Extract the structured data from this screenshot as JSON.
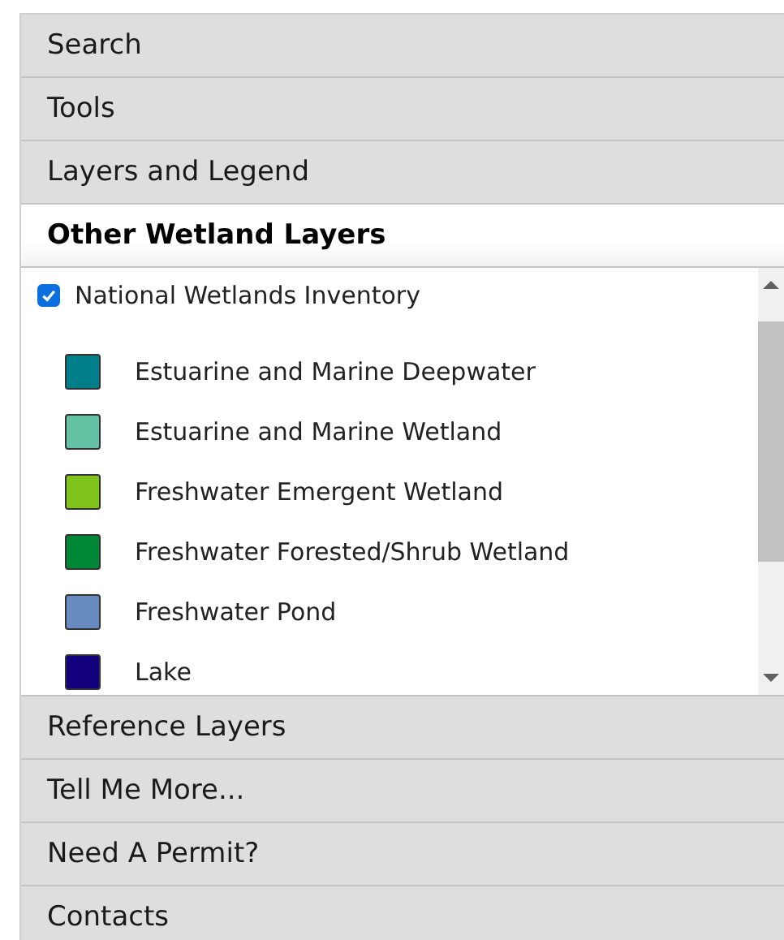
{
  "sections": [
    {
      "title": "Search",
      "expanded": false
    },
    {
      "title": "Tools",
      "expanded": false
    },
    {
      "title": "Layers and Legend",
      "expanded": false
    },
    {
      "title": "Other Wetland Layers",
      "expanded": true,
      "layers": [
        {
          "label": "National Wetlands Inventory",
          "checked": true,
          "legend": [
            {
              "label": "Estuarine and Marine Deepwater",
              "color": "#007f8a"
            },
            {
              "label": "Estuarine and Marine Wetland",
              "color": "#66c2a5"
            },
            {
              "label": "Freshwater Emergent Wetland",
              "color": "#7fc31c"
            },
            {
              "label": "Freshwater Forested/Shrub Wetland",
              "color": "#008837"
            },
            {
              "label": "Freshwater Pond",
              "color": "#688cc0"
            },
            {
              "label": "Lake",
              "color": "#13007c"
            }
          ]
        }
      ]
    },
    {
      "title": "Reference Layers",
      "expanded": false
    },
    {
      "title": "Tell Me More...",
      "expanded": false
    },
    {
      "title": "Need A Permit?",
      "expanded": false
    },
    {
      "title": "Contacts",
      "expanded": false
    }
  ]
}
